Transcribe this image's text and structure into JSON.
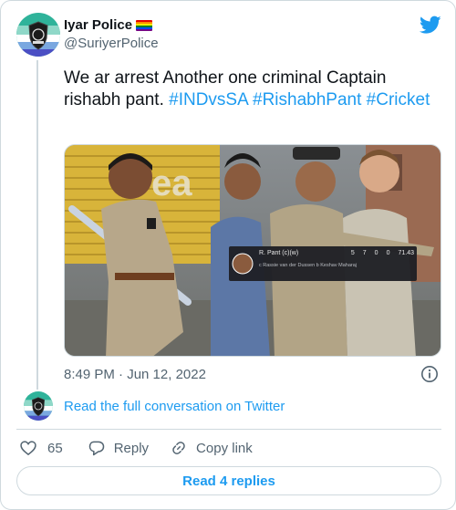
{
  "author": {
    "display_name": "Iyar Police",
    "handle": "@SuriyerPolice",
    "avatar_icon": "police-badge-icon",
    "flag_icon": "rainbow-flag-icon"
  },
  "brand": {
    "icon": "twitter-bird-icon",
    "color": "#1d9bf0"
  },
  "tweet": {
    "text_plain": "We ar arrest Another one criminal Captain rishabh pant.",
    "hashtags": [
      "#INDvsSA",
      "#RishabhPant",
      "#Cricket"
    ],
    "timestamp": "8:49 PM · Jun 12, 2022"
  },
  "media": {
    "description_icon": "photo",
    "scoreboard": {
      "player": "R. Pant (c)(w)",
      "balls": "5",
      "runs": "7",
      "fours": "0",
      "sixes": "0",
      "strike_rate": "71.43",
      "dismissal": "c Rassie van der Dussen b Keshav Maharaj"
    }
  },
  "conversation_link": "Read the full conversation on Twitter",
  "actions": {
    "like_count": "65",
    "reply_label": "Reply",
    "copy_link_label": "Copy link"
  },
  "read_replies_label": "Read 4 replies",
  "colors": {
    "text_primary": "#0f1419",
    "text_secondary": "#536471",
    "link": "#1d9bf0",
    "border": "#cfd9de"
  }
}
